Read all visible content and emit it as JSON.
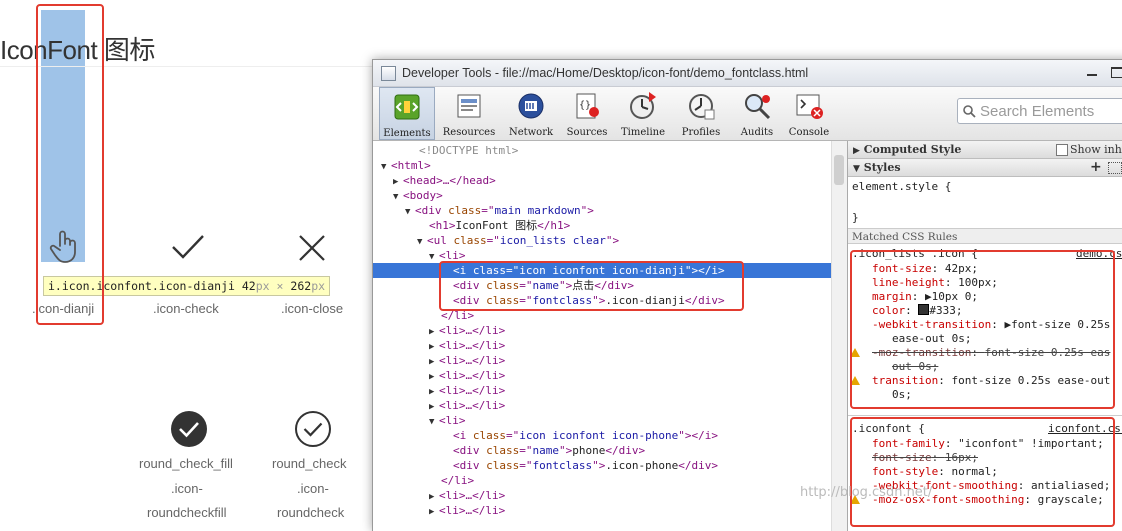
{
  "page": {
    "title": "IconFont 图标",
    "icons": [
      {
        "label": ".icon-dianji"
      },
      {
        "label": ".icon-check"
      },
      {
        "label": ".icon-close"
      },
      {
        "label": "round_check_fill",
        "label2": ".icon-",
        "label3": "roundcheckfill"
      },
      {
        "label": "round_check",
        "label2": ".icon-",
        "label3": "roundcheck"
      }
    ],
    "tooltip": {
      "selector": "i.icon.iconfont.icon-dianji",
      "width": "42",
      "unit_w": "px",
      "times": "×",
      "height": "262",
      "unit_h": "px"
    }
  },
  "devtools": {
    "window_title": "Developer Tools - file://mac/Home/Desktop/icon-font/demo_fontclass.html",
    "toolbar": [
      {
        "label": "Elements",
        "icon": "elements-icon"
      },
      {
        "label": "Resources",
        "icon": "resources-icon"
      },
      {
        "label": "Network",
        "icon": "network-icon"
      },
      {
        "label": "Sources",
        "icon": "sources-icon"
      },
      {
        "label": "Timeline",
        "icon": "timeline-icon"
      },
      {
        "label": "Profiles",
        "icon": "profiles-icon"
      },
      {
        "label": "Audits",
        "icon": "audits-icon"
      },
      {
        "label": "Console",
        "icon": "console-icon"
      }
    ],
    "search_placeholder": "Search Elements",
    "tree": {
      "doctype": "<!DOCTYPE html>",
      "html": "<html>",
      "head": "<head>…</head>",
      "body": "<body>",
      "div_main": {
        "tag": "div",
        "attr": "class",
        "val": "main markdown"
      },
      "h1": {
        "open": "<h1>",
        "text": "IconFont 图标",
        "close": "</h1>"
      },
      "ul": {
        "tag": "ul",
        "attr": "class",
        "val": "icon_lists clear"
      },
      "li_open": "<li>",
      "li_close": "</li>",
      "li_collapsed": "<li>…</li>",
      "i_dianji": {
        "tag": "i",
        "attr": "class",
        "val": "icon iconfont icon-dianji",
        "close": "></i>"
      },
      "div_name_1": {
        "val": "name",
        "text": "点击"
      },
      "div_fc_1": {
        "val": "fontclass",
        "text": ".icon-dianji"
      },
      "i_phone": {
        "val": "icon iconfont icon-phone"
      },
      "div_name_2": {
        "val": "name",
        "text": "phone"
      },
      "div_fc_2": {
        "val": "fontclass",
        "text": ".icon-phone"
      }
    },
    "styles": {
      "computed_hd": "Computed Style",
      "show_inherited": "Show inhe",
      "styles_hd": "Styles",
      "element_style": "element.style {",
      "brace_close": "}",
      "matched_hd": "Matched CSS Rules",
      "rule1": {
        "selector": ".icon_lists .icon {",
        "source": "demo.css",
        "props": [
          {
            "n": "font-size",
            "v": "42px;"
          },
          {
            "n": "line-height",
            "v": "100px;"
          },
          {
            "n": "margin",
            "v": "▶10px 0;"
          },
          {
            "n": "color",
            "v": "#333;",
            "swatch": "#333333"
          },
          {
            "n": "-webkit-transition",
            "v": "▶font-size 0.25s"
          },
          {
            "n": "",
            "v": "ease-out 0s;"
          },
          {
            "n": "-moz-transition",
            "v": "font-size 0.25s eas"
          },
          {
            "n": "",
            "v": "out 0s;"
          },
          {
            "n": "transition",
            "v": "font-size 0.25s ease-out"
          },
          {
            "n": "",
            "v": "0s;"
          }
        ]
      },
      "rule2": {
        "selector": ".iconfont {",
        "source": "iconfont.css",
        "props": [
          {
            "n": "font-family",
            "v": "\"iconfont\" !important;"
          },
          {
            "n": "font-size",
            "v": "16px;"
          },
          {
            "n": "font-style",
            "v": "normal;"
          },
          {
            "n": "-webkit-font-smoothing",
            "v": "antialiased;"
          },
          {
            "n": "-moz-osx-font-smoothing",
            "v": "grayscale;"
          }
        ]
      }
    }
  },
  "watermark": "http://blog.csdn.net/",
  "colors": {
    "highlight": "#3875d7",
    "annotation": "#e23b2f"
  }
}
